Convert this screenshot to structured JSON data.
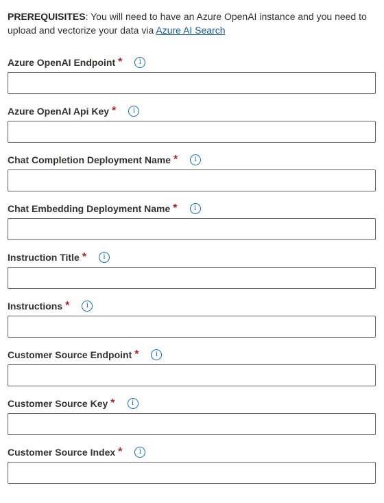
{
  "prereq": {
    "bold": "PREREQUISITES",
    "text": ": You will need to have an Azure OpenAI instance and you need to upload and vectorize your data via ",
    "link": "Azure AI Search"
  },
  "fields": [
    {
      "label": "Azure OpenAI Endpoint",
      "required": "*",
      "value": ""
    },
    {
      "label": "Azure OpenAI Api Key",
      "required": "*",
      "value": ""
    },
    {
      "label": "Chat Completion Deployment Name",
      "required": "*",
      "value": ""
    },
    {
      "label": "Chat Embedding Deployment Name",
      "required": "*",
      "value": ""
    },
    {
      "label": "Instruction Title",
      "required": "*",
      "value": ""
    },
    {
      "label": "Instructions",
      "required": "*",
      "value": ""
    },
    {
      "label": "Customer Source Endpoint",
      "required": "*",
      "value": ""
    },
    {
      "label": "Customer Source Key",
      "required": "*",
      "value": ""
    },
    {
      "label": "Customer Source Index",
      "required": "*",
      "value": ""
    }
  ],
  "icons": {
    "info": "ⓘ-info-icon"
  },
  "colors": {
    "link": "#115ea3",
    "required": "#a4262c",
    "info": "#0f6cbd",
    "border": "#605e5c"
  }
}
